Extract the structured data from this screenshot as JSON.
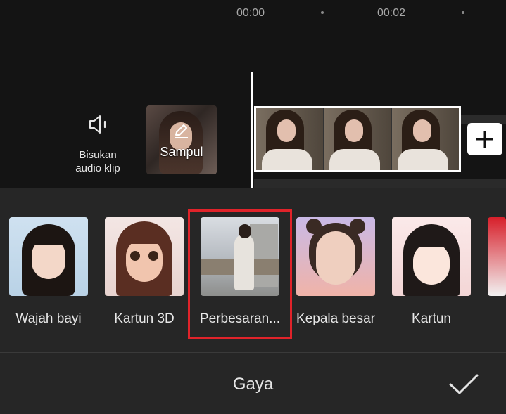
{
  "timeline": {
    "time_marks": [
      "00:00",
      "00:02"
    ],
    "mute": {
      "label": "Bisukan\naudio klip",
      "icon": "speaker-icon"
    },
    "cover": {
      "label": "Sampul",
      "icon": "pencil-icon"
    },
    "add_icon": "plus-icon"
  },
  "effects": {
    "items": [
      {
        "label": "Wajah bayi"
      },
      {
        "label": "Kartun 3D"
      },
      {
        "label": "Perbesaran..."
      },
      {
        "label": "Kepala besar"
      },
      {
        "label": "Kartun"
      }
    ],
    "selected_index": 2,
    "selection_color": "#e0232a"
  },
  "footer": {
    "title": "Gaya",
    "confirm_icon": "checkmark-icon"
  }
}
